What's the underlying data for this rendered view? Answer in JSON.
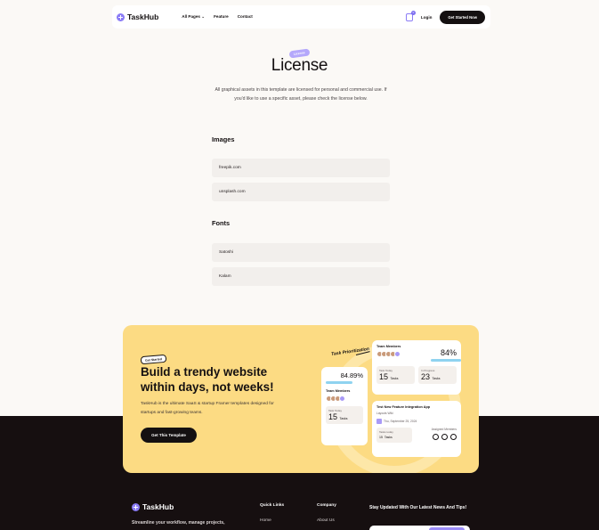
{
  "nav": {
    "brand": "TaskHub",
    "links": [
      "All Pages",
      "Feature",
      "Contact"
    ],
    "cart_count": "0",
    "login": "Login",
    "cta": "Get Started Now"
  },
  "hero": {
    "badge": "License",
    "title": "License",
    "subtitle": "All graphical assets in this template are licensed for personal and commercial use. If you'd like to use a specific asset, please check the license below."
  },
  "images": {
    "heading": "Images",
    "items": [
      "freepik.com",
      "unsplash.com"
    ]
  },
  "fonts": {
    "heading": "Fonts",
    "items": [
      "Satoshi",
      "Kalam"
    ]
  },
  "cta": {
    "badge": "Get Started",
    "heading": "Build a trendy website within days, not weeks!",
    "description": "TaskHub is the ultimate SaaS & startup Framer templates designed for startups and fast-growing teams.",
    "button": "Get This Template",
    "task_label": "Task Prioritization",
    "card_members": {
      "title": "Team Members",
      "percent": "84%",
      "stat1_label": "Task Today",
      "stat1_value": "15",
      "stat1_unit": "Tasks",
      "stat2_label": "In Progress",
      "stat2_value": "23",
      "stat2_unit": "Tasks"
    },
    "card_small": {
      "percent": "84.89%",
      "title": "Team Members",
      "stat_label": "Task Today",
      "stat_value": "15",
      "stat_unit": "Tasks"
    },
    "card_feature": {
      "title": "Test New Feature Integration App",
      "sub": "Layouts Wiki",
      "date": "Thu, September 25, 2024",
      "stat_label": "Tasks today",
      "stat_value": "15",
      "stat_unit": "Tasks",
      "assigned": "Assigned Members"
    }
  },
  "footer": {
    "brand": "TaskHub",
    "tagline": "Streamline your workflow, manage projects,",
    "col1_head": "Quick Links",
    "col1_link": "Home",
    "col2_head": "Company",
    "col2_link": "About Us",
    "newsletter": "Stay Updated With Our Latest News And Tips!"
  },
  "colors": {
    "accent": "#8b7cf6",
    "cta_bg": "#fcdb83",
    "dark": "#160f10"
  }
}
